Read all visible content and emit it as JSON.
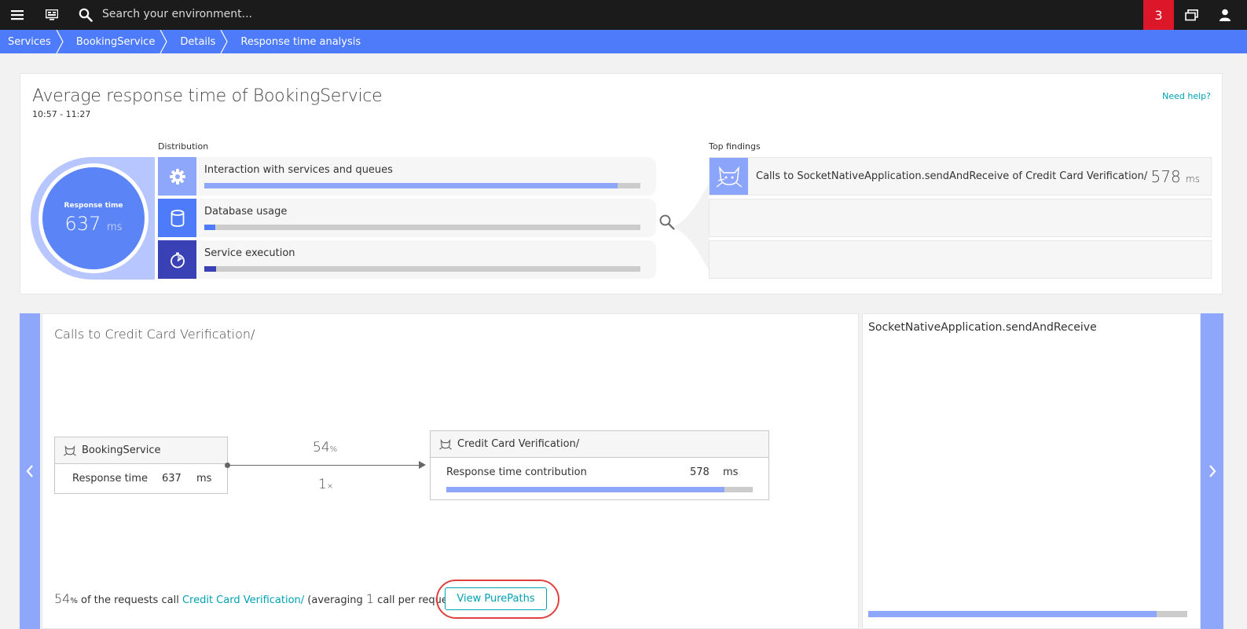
{
  "topbar": {
    "search_placeholder": "Search your environment...",
    "notification_count": "3"
  },
  "breadcrumb": [
    "Services",
    "BookingService",
    "Details",
    "Response time analysis"
  ],
  "analysis": {
    "title": "Average response time of BookingService",
    "timeframe": "10:57 - 11:27",
    "help_label": "Need help?",
    "gauge": {
      "label": "Response time",
      "value": "637",
      "unit": "ms"
    },
    "distribution_label": "Distribution",
    "distribution": [
      {
        "label": "Interaction with services and queues",
        "fraction": 0.948,
        "color": "#8ea7fb",
        "icon_color": "#8ea7fb",
        "icon": "gear-icon"
      },
      {
        "label": "Database usage",
        "fraction": 0.025,
        "color": "#4d7bf9",
        "icon_color": "#4d7bf9",
        "icon": "database-icon"
      },
      {
        "label": "Service execution",
        "fraction": 0.027,
        "color": "#3941b5",
        "icon_color": "#3941b5",
        "icon": "stopwatch-icon"
      }
    ],
    "top_findings_label": "Top findings",
    "top_findings": [
      {
        "label": "Calls to SocketNativeApplication.sendAndReceive of Credit Card Verification/",
        "value": "578",
        "unit": "ms",
        "icon": "tomcat-icon"
      }
    ]
  },
  "calls": {
    "title": "Calls to Credit Card Verification/",
    "source": {
      "name": "BookingService",
      "metric_label": "Response time",
      "metric_value": "637",
      "metric_unit": "ms"
    },
    "connection": {
      "percent": "54",
      "percent_unit": "%",
      "count": "1",
      "count_unit": "×"
    },
    "target": {
      "name": "Credit Card Verification/",
      "metric_label": "Response time contribution",
      "metric_value": "578",
      "metric_unit": "ms",
      "fraction": 0.907
    },
    "summary": {
      "percent": "54",
      "percent_unit": "%",
      "text1": "of the requests call",
      "link": "Credit Card Verification/",
      "text2": "(averaging",
      "avg": "1",
      "text3": "call per request)"
    },
    "view_purepaths_label": "View PurePaths"
  },
  "detail": {
    "title": "SocketNativeApplication.sendAndReceive",
    "fraction": 0.905
  },
  "colors": {
    "topbar": "#1b1b1b",
    "breadcrumb": "#4d7bf9",
    "accent_teal": "#00a1b2",
    "notification": "#dc172a",
    "highlight": "#e0413f"
  }
}
